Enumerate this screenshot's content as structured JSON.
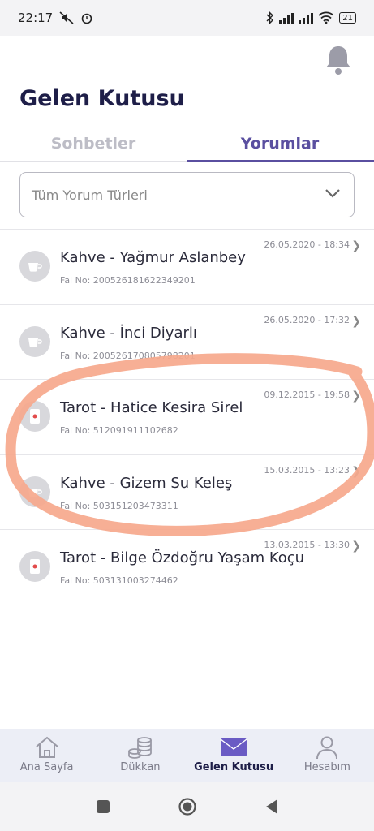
{
  "status_bar": {
    "time": "22:17",
    "battery": "21"
  },
  "header": {
    "title": "Gelen Kutusu"
  },
  "tabs": [
    {
      "label": "Sohbetler",
      "active": false
    },
    {
      "label": "Yorumlar",
      "active": true
    }
  ],
  "filter": {
    "selected": "Tüm Yorum Türleri"
  },
  "comments": [
    {
      "title": "Kahve - Yağmur Aslanbey",
      "fal_no": "Fal No: 200526181622349201",
      "date": "26.05.2020 - 18:34",
      "icon": "coffee-cup-icon"
    },
    {
      "title": "Kahve - İnci Diyarlı",
      "fal_no": "Fal No: 200526170805798201",
      "date": "26.05.2020 - 17:32",
      "icon": "coffee-cup-icon"
    },
    {
      "title": "Tarot - Hatice Kesira Sirel",
      "fal_no": "Fal No: 512091911102682",
      "date": "09.12.2015 - 19:58",
      "icon": "tarot-card-icon"
    },
    {
      "title": "Kahve - Gizem Su Keleş",
      "fal_no": "Fal No: 503151203473311",
      "date": "15.03.2015 - 13:23",
      "icon": "coffee-cup-icon"
    },
    {
      "title": "Tarot - Bilge Özdoğru Yaşam Koçu",
      "fal_no": "Fal No: 503131003274462",
      "date": "13.03.2015 - 13:30",
      "icon": "tarot-card-icon"
    }
  ],
  "bottom_nav": [
    {
      "label": "Ana Sayfa",
      "icon": "home-icon",
      "active": false
    },
    {
      "label": "Dükkan",
      "icon": "coins-icon",
      "active": false
    },
    {
      "label": "Gelen Kutusu",
      "icon": "envelope-icon",
      "active": true
    },
    {
      "label": "Hesabım",
      "icon": "user-icon",
      "active": false
    }
  ],
  "colors": {
    "accent": "#5a4fa0",
    "title": "#1e1e48",
    "scribble": "#f6a88c"
  }
}
